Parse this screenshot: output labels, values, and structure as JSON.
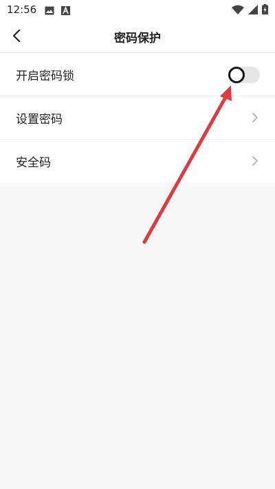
{
  "status_bar": {
    "time": "12:56",
    "icons": [
      "image-icon",
      "a-badge-icon",
      "wifi-icon",
      "signal-icon",
      "battery-charging-icon"
    ]
  },
  "header": {
    "title": "密码保护",
    "back_icon": "back-arrow-icon"
  },
  "settings": {
    "items": [
      {
        "label": "开启密码锁",
        "control": "toggle",
        "toggle_on": false
      },
      {
        "label": "设置密码",
        "control": "chevron"
      },
      {
        "label": "安全码",
        "control": "chevron"
      }
    ]
  },
  "colors": {
    "page_bg": "#f7f7f7",
    "annotation_arrow": "#e0393e",
    "toggle_track_off": "#e6e6e6"
  }
}
